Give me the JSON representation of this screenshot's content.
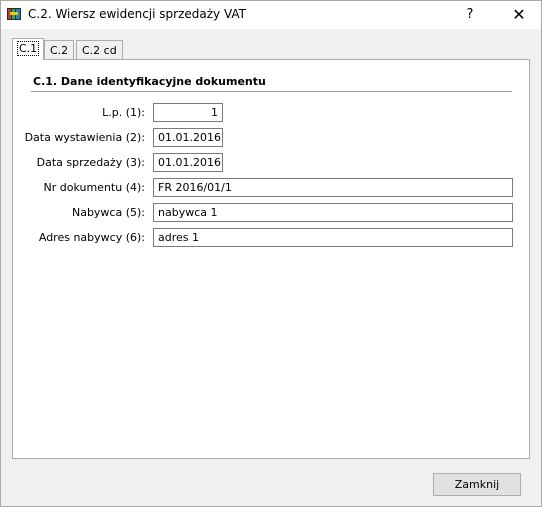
{
  "window": {
    "title": "C.2. Wiersz ewidencji sprzedaży VAT",
    "help_label": "?",
    "close_label": "✕"
  },
  "tabs": [
    {
      "label": "C.1",
      "active": true
    },
    {
      "label": "C.2",
      "active": false
    },
    {
      "label": "C.2 cd",
      "active": false
    }
  ],
  "section": {
    "title": "C.1. Dane identyfikacyjne dokumentu"
  },
  "fields": {
    "lp": {
      "label": "L.p. (1):",
      "value": "1"
    },
    "data_wystawienia": {
      "label": "Data wystawienia (2):",
      "value": "01.01.2016"
    },
    "data_sprzedazy": {
      "label": "Data sprzedaży (3):",
      "value": "01.01.2016"
    },
    "nr_dokumentu": {
      "label": "Nr dokumentu (4):",
      "value": "FR 2016/01/1"
    },
    "nabywca": {
      "label": "Nabywca (5):",
      "value": "nabywca 1"
    },
    "adres_nabywcy": {
      "label": "Adres nabywcy (6):",
      "value": "adres 1"
    }
  },
  "footer": {
    "close_button": "Zamknij"
  },
  "colors": {
    "annotation_arrow": "#ff0000"
  }
}
